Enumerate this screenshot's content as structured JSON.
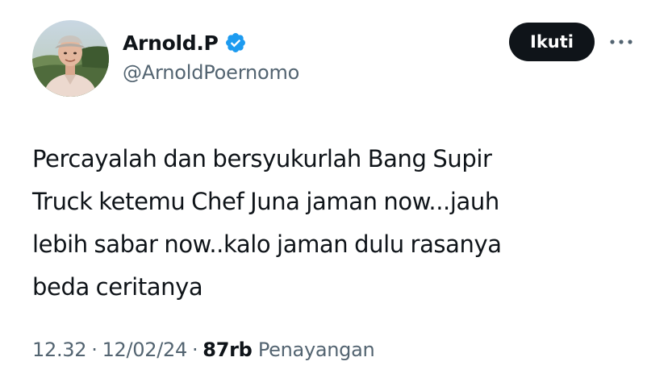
{
  "author": {
    "display_name": "Arnold.P",
    "handle": "@ArnoldPoernomo",
    "verified": true,
    "verified_badge_color": "#1d9bf0"
  },
  "actions": {
    "follow_label": "Ikuti",
    "more_icon": "more-horizontal-icon"
  },
  "tweet": {
    "lines": [
      "Percayalah dan bersyukurlah Bang Supir",
      "Truck ketemu Chef Juna jaman now...jauh",
      "lebih sabar now..kalo jaman dulu rasanya",
      "beda ceritanya"
    ]
  },
  "meta": {
    "time": "12.32",
    "date": "12/02/24",
    "separator": "·",
    "views_count": "87rb",
    "views_label": "Penayangan"
  },
  "colors": {
    "text_primary": "#0f1419",
    "text_secondary": "#536471",
    "button_bg": "#0f1419",
    "button_text": "#ffffff"
  }
}
